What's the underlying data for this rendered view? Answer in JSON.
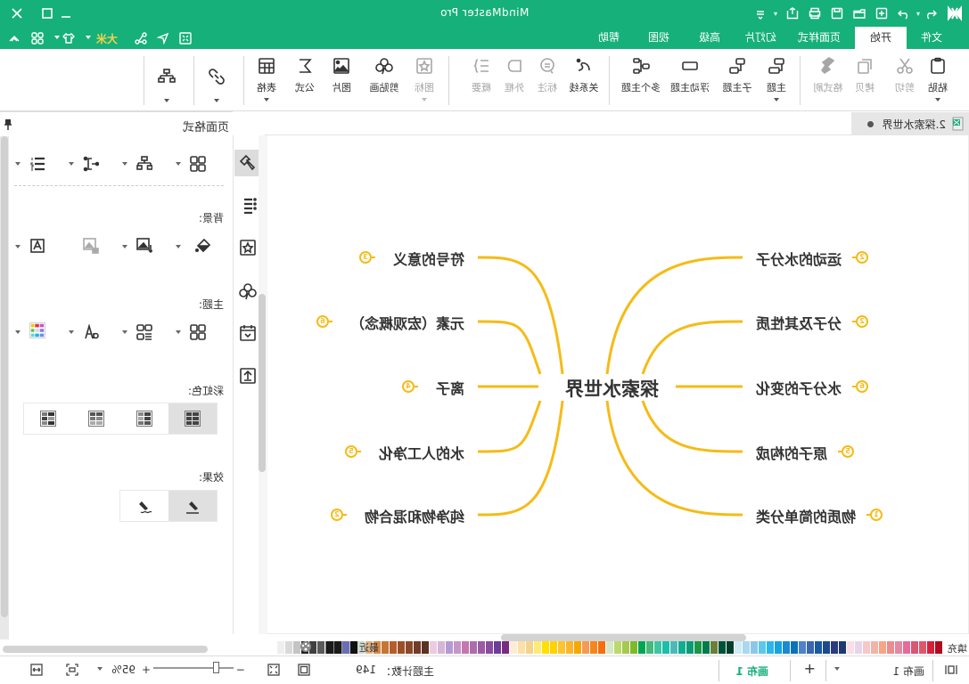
{
  "window": {
    "title": "MindMaster Pro",
    "quick_access": [
      "logo-icon",
      "undo-icon",
      "redo-icon",
      "new-icon",
      "open-icon",
      "save-icon",
      "print-icon",
      "export-icon",
      "customize-icon"
    ],
    "controls": [
      "minimize",
      "maximize",
      "close"
    ]
  },
  "menu_tabs": [
    {
      "label": "文件",
      "active": false
    },
    {
      "label": "开始",
      "active": true
    },
    {
      "label": "页面样式",
      "active": false
    },
    {
      "label": "幻灯片",
      "active": false
    },
    {
      "label": "高级",
      "active": false
    },
    {
      "label": "视图",
      "active": false
    },
    {
      "label": "帮助",
      "active": false
    }
  ],
  "tab_row_tools": {
    "font_size_label": "大米",
    "icons": [
      "fullscreen-icon",
      "select-icon",
      "connect-icon",
      "theme-icon",
      "layout-icon",
      "collapse-ribbon-icon"
    ]
  },
  "ribbon": {
    "clipboard": [
      {
        "label": "粘贴",
        "icon": "paste-icon",
        "dropdown": true,
        "enabled": true
      },
      {
        "label": "剪切",
        "icon": "cut-icon",
        "enabled": false
      },
      {
        "label": "拷贝",
        "icon": "copy-icon",
        "enabled": false
      },
      {
        "label": "格式刷",
        "icon": "format-painter-icon",
        "enabled": false
      }
    ],
    "topics": [
      {
        "label": "主题",
        "icon": "topic-icon",
        "dropdown": true,
        "enabled": true
      },
      {
        "label": "子主题",
        "icon": "subtopic-icon",
        "enabled": true
      },
      {
        "label": "浮动主题",
        "icon": "floating-topic-icon",
        "enabled": true
      },
      {
        "label": "多个主题",
        "icon": "multiple-topics-icon",
        "enabled": true
      }
    ],
    "insert": [
      {
        "label": "关系线",
        "icon": "relationship-icon",
        "enabled": true
      },
      {
        "label": "标注",
        "icon": "callout-icon",
        "enabled": false
      },
      {
        "label": "外框",
        "icon": "boundary-icon",
        "enabled": false
      },
      {
        "label": "概要",
        "icon": "summary-icon",
        "enabled": false
      }
    ],
    "objects": [
      {
        "label": "图标",
        "icon": "mark-icon",
        "dropdown": true,
        "enabled": false
      },
      {
        "label": "剪贴画",
        "icon": "clipart-icon",
        "enabled": true
      },
      {
        "label": "图片",
        "icon": "picture-icon",
        "enabled": true
      },
      {
        "label": "公式",
        "icon": "formula-icon",
        "enabled": true
      },
      {
        "label": "表格",
        "icon": "table-icon",
        "dropdown": true,
        "enabled": true
      }
    ],
    "extra": [
      {
        "label": "",
        "icon": "link-icon",
        "dropdown": true
      },
      {
        "label": "",
        "icon": "layout-icon",
        "dropdown": true
      }
    ]
  },
  "document_tab": {
    "name": "2.探索水世界",
    "modified": true
  },
  "mindmap": {
    "root": "探索水世界",
    "right_branches": [
      {
        "label": "符号的意义",
        "badge": "3"
      },
      {
        "label": "元素（宏观概念）",
        "badge": "6"
      },
      {
        "label": "离子",
        "badge": "4"
      },
      {
        "label": "水的人工净化",
        "badge": "5"
      },
      {
        "label": "纯净物和混合物",
        "badge": "2"
      }
    ],
    "left_branches": [
      {
        "label": "运动的水分子",
        "badge": "2"
      },
      {
        "label": "分子及其性质",
        "badge": "2"
      },
      {
        "label": "水分子的变化",
        "badge": "6"
      },
      {
        "label": "原子的构成",
        "badge": "5"
      },
      {
        "label": "物质的简单分类",
        "badge": "1"
      }
    ],
    "line_color": "#f5bb17"
  },
  "color_bar": {
    "fill_label": "填充",
    "recent_label": "最近",
    "recent_colors": [
      "#111111",
      "#6a6fb5",
      "#1a1a1a",
      "#1a1a1a"
    ],
    "swatches": [
      "#b00b1e",
      "#d6213a",
      "#e0566b",
      "#d85775",
      "#e86a9a",
      "#e08aa3",
      "#ee8b8f",
      "#f6a586",
      "#f2b3a8",
      "#f6c8c8",
      "#e8d4e8",
      "#fbdde6",
      "#1e3870",
      "#2c3b7c",
      "#1d4a8d",
      "#195aa3",
      "#3b66b0",
      "#4f82c8",
      "#0b71bd",
      "#1a8ad3",
      "#16a3e3",
      "#2cb6ec",
      "#5cc8ee",
      "#8cc7e7",
      "#a9d8ef",
      "#d0eaf6",
      "#003e2d",
      "#00513a",
      "#6a7f39",
      "#007b4a",
      "#1b9845",
      "#0b9b77",
      "#10ae8f",
      "#4cb9b8",
      "#1dbeaa",
      "#3cc6a2",
      "#47b97a",
      "#00a651",
      "#7db92a",
      "#a5c84f",
      "#bcd96b",
      "#d4e8c6",
      "#f36f0f",
      "#f7851e",
      "#f49a54",
      "#f6a800",
      "#fbb52d",
      "#fdc331",
      "#ffd200",
      "#ffe000",
      "#fdeb77",
      "#f4d38e",
      "#fde0a6",
      "#fdecd7",
      "#7a2c7c",
      "#6c3e98",
      "#8a4ca0",
      "#9b5ba4",
      "#ac6eaa",
      "#c578ae",
      "#c795c8",
      "#b49ad3",
      "#d5b5d8",
      "#ebcbe0",
      "#5b3324",
      "#733b2a",
      "#8a4a2a",
      "#9c5026",
      "#b75c2c",
      "#c77537",
      "#d98b47",
      "#e1b184",
      "#cfd8cc",
      "#c7c7c7",
      "#9c9c9c",
      "#888888",
      "#707070",
      "#5a5a5a",
      "#404040",
      "#222222",
      "#c4c4c4",
      "#d9d9d9",
      "#eeeeee"
    ]
  },
  "status_bar": {
    "pages": [
      {
        "label": "画布 1",
        "active": false
      },
      {
        "label": "画布 1",
        "active": true
      }
    ],
    "add_page": "+",
    "topic_count_label": "主题计数：",
    "topic_count": "149",
    "zoom_level": "95%",
    "zoom_out": "−",
    "zoom_in": "+"
  },
  "right_panel": {
    "title": "页面格式",
    "side_tools": [
      "format-painter-icon",
      "outline-icon",
      "mark-icon",
      "clipart-icon",
      "task-icon",
      "export-icon"
    ],
    "layout_row": [
      "layout-icon",
      "structure-icon",
      "connector-icon",
      "numbering-icon"
    ],
    "background": {
      "label": "背景:",
      "buttons": [
        "fill-bucket-icon",
        "insert-background-image-icon",
        "remove-background-image-icon",
        "watermark-icon"
      ]
    },
    "theme": {
      "label": "主题:",
      "buttons": [
        "theme-layout-icon",
        "theme-layout-alt-icon",
        "font-icon",
        "color-theme-icon"
      ]
    },
    "rainbow": {
      "label": "彩虹色:",
      "options": [
        "rainbow-style-1",
        "rainbow-style-2",
        "rainbow-style-3",
        "rainbow-style-4"
      ],
      "selected_index": 0
    },
    "effect": {
      "label": "效果:",
      "options": [
        "pen-straight-icon",
        "pen-hand-drawn-icon"
      ],
      "selected_index": 0
    }
  }
}
